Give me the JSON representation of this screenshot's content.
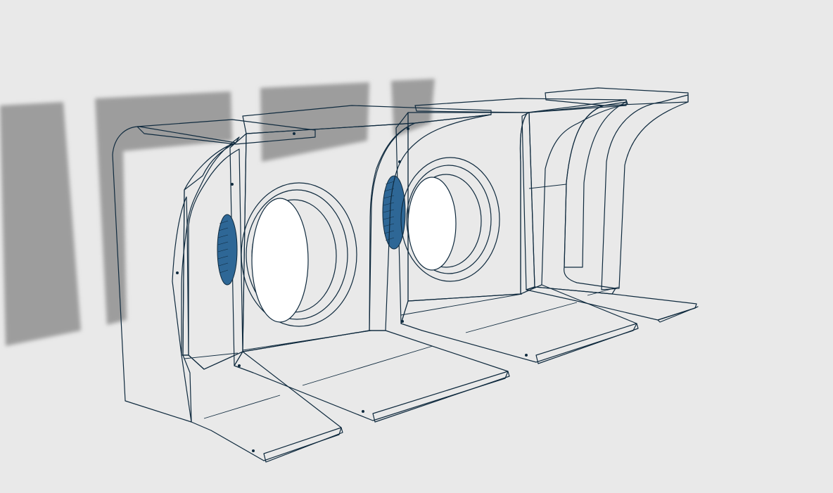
{
  "viewport": {
    "background": "#e9e9e9",
    "shadow_color": "#9a9a9a"
  },
  "model": {
    "part_color": "#4a8fc4",
    "part_color_light": "#5da3d6",
    "part_color_dark": "#1c3a4f",
    "edge_color": "#0f2a3e",
    "parts": [
      {
        "id": "part-1",
        "kind": "stand-solid-back"
      },
      {
        "id": "part-2",
        "kind": "stand-with-round-hole"
      },
      {
        "id": "part-3",
        "kind": "stand-with-round-hole"
      },
      {
        "id": "part-4",
        "kind": "stand-open-back"
      }
    ]
  }
}
